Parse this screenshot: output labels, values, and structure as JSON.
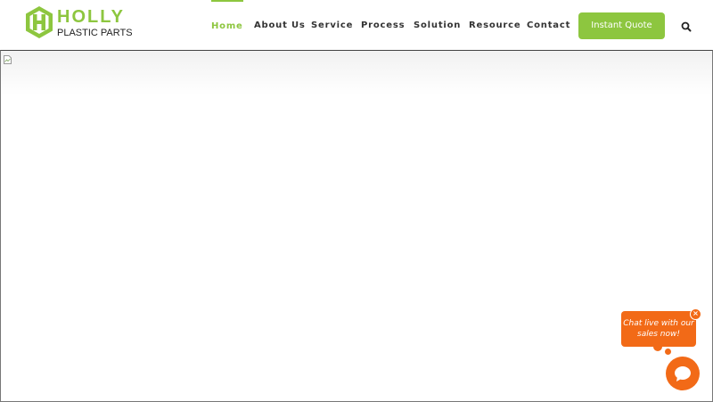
{
  "brand": {
    "name": "HOLLY",
    "tagline": "PLASTIC PARTS",
    "color": "#8dc63f"
  },
  "nav": {
    "items": [
      {
        "label": "Home",
        "active": true
      },
      {
        "label": "About Us",
        "active": false
      },
      {
        "label": "Service",
        "active": false
      },
      {
        "label": "Process",
        "active": false
      },
      {
        "label": "Solution",
        "active": false
      },
      {
        "label": "Resource",
        "active": false
      },
      {
        "label": "Contact",
        "active": false
      }
    ],
    "cta_label": "Instant Quote",
    "search_icon": "search-icon"
  },
  "content": {
    "broken_image_icon": "broken-image-icon"
  },
  "chat": {
    "prompt": "Chat live with our sales now!",
    "close_icon": "close-icon",
    "launcher_icon": "chat-bubble-icon",
    "accent": "#f26a17"
  }
}
